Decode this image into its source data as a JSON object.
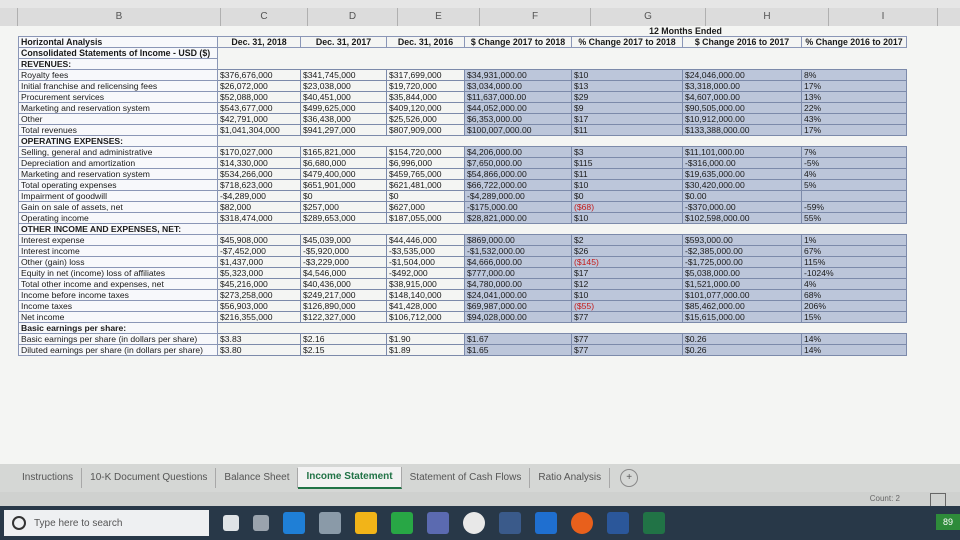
{
  "columns": [
    "B",
    "C",
    "D",
    "E",
    "F",
    "G",
    "H",
    "I"
  ],
  "header": {
    "group_title": "12 Months Ended",
    "title1": "Horizontal Analysis",
    "title2": "Consolidated Statements of Income - USD ($)",
    "cols": [
      "Dec. 31, 2018",
      "Dec. 31, 2017",
      "Dec. 31, 2016",
      "$ Change 2017 to 2018",
      "% Change 2017 to 2018",
      "$ Change 2016 to 2017",
      "% Change 2016 to 2017"
    ]
  },
  "sections": [
    {
      "title": "REVENUES:",
      "rows": [
        {
          "label": "Royalty fees",
          "v": [
            "$376,676,000",
            "$341,745,000",
            "$317,699,000",
            "$34,931,000.00",
            "$10",
            "$24,046,000.00",
            "8%"
          ]
        },
        {
          "label": "Initial franchise and relicensing fees",
          "v": [
            "$26,072,000",
            "$23,038,000",
            "$19,720,000",
            "$3,034,000.00",
            "$13",
            "$3,318,000.00",
            "17%"
          ]
        },
        {
          "label": "Procurement services",
          "v": [
            "$52,088,000",
            "$40,451,000",
            "$35,844,000",
            "$11,637,000.00",
            "$29",
            "$4,607,000.00",
            "13%"
          ]
        },
        {
          "label": "Marketing and reservation system",
          "v": [
            "$543,677,000",
            "$499,625,000",
            "$409,120,000",
            "$44,052,000.00",
            "$9",
            "$90,505,000.00",
            "22%"
          ]
        },
        {
          "label": "Other",
          "v": [
            "$42,791,000",
            "$36,438,000",
            "$25,526,000",
            "$6,353,000.00",
            "$17",
            "$10,912,000.00",
            "43%"
          ]
        },
        {
          "label": "Total revenues",
          "v": [
            "$1,041,304,000",
            "$941,297,000",
            "$807,909,000",
            "$100,007,000.00",
            "$11",
            "$133,388,000.00",
            "17%"
          ]
        }
      ]
    },
    {
      "title": "OPERATING EXPENSES:",
      "rows": [
        {
          "label": "Selling, general and administrative",
          "v": [
            "$170,027,000",
            "$165,821,000",
            "$154,720,000",
            "$4,206,000.00",
            "$3",
            "$11,101,000.00",
            "7%"
          ]
        },
        {
          "label": "Depreciation and amortization",
          "v": [
            "$14,330,000",
            "$6,680,000",
            "$6,996,000",
            "$7,650,000.00",
            "$115",
            "-$316,000.00",
            "-5%"
          ]
        },
        {
          "label": "Marketing and reservation system",
          "v": [
            "$534,266,000",
            "$479,400,000",
            "$459,765,000",
            "$54,866,000.00",
            "$11",
            "$19,635,000.00",
            "4%"
          ]
        },
        {
          "label": "Total operating expenses",
          "v": [
            "$718,623,000",
            "$651,901,000",
            "$621,481,000",
            "$66,722,000.00",
            "$10",
            "$30,420,000.00",
            "5%"
          ]
        },
        {
          "label": "Impairment of goodwill",
          "v": [
            "-$4,289,000",
            "$0",
            "$0",
            "-$4,289,000.00",
            "$0",
            "$0.00",
            ""
          ]
        },
        {
          "label": "Gain on sale of assets, net",
          "v": [
            "$82,000",
            "$257,000",
            "$627,000",
            "-$175,000.00",
            "($68)",
            "-$370,000.00",
            "-59%"
          ]
        },
        {
          "label": "Operating income",
          "v": [
            "$318,474,000",
            "$289,653,000",
            "$187,055,000",
            "$28,821,000.00",
            "$10",
            "$102,598,000.00",
            "55%"
          ]
        }
      ]
    },
    {
      "title": "OTHER INCOME AND EXPENSES, NET:",
      "rows": [
        {
          "label": "Interest expense",
          "v": [
            "$45,908,000",
            "$45,039,000",
            "$44,446,000",
            "$869,000.00",
            "$2",
            "$593,000.00",
            "1%"
          ]
        },
        {
          "label": "Interest income",
          "v": [
            "-$7,452,000",
            "-$5,920,000",
            "-$3,535,000",
            "-$1,532,000.00",
            "$26",
            "-$2,385,000.00",
            "67%"
          ]
        },
        {
          "label": "Other (gain) loss",
          "v": [
            "$1,437,000",
            "-$3,229,000",
            "-$1,504,000",
            "$4,666,000.00",
            "($145)",
            "-$1,725,000.00",
            "115%"
          ]
        },
        {
          "label": "Equity in net (income) loss of affiliates",
          "v": [
            "$5,323,000",
            "$4,546,000",
            "-$492,000",
            "$777,000.00",
            "$17",
            "$5,038,000.00",
            "-1024%"
          ]
        },
        {
          "label": "Total other income and expenses, net",
          "v": [
            "$45,216,000",
            "$40,436,000",
            "$38,915,000",
            "$4,780,000.00",
            "$12",
            "$1,521,000.00",
            "4%"
          ]
        },
        {
          "label": "Income before income taxes",
          "v": [
            "$273,258,000",
            "$249,217,000",
            "$148,140,000",
            "$24,041,000.00",
            "$10",
            "$101,077,000.00",
            "68%"
          ]
        },
        {
          "label": "Income taxes",
          "v": [
            "$56,903,000",
            "$126,890,000",
            "$41,428,000",
            "$69,987,000.00",
            "($55)",
            "$85,462,000.00",
            "206%"
          ]
        },
        {
          "label": "Net income",
          "v": [
            "$216,355,000",
            "$122,327,000",
            "$106,712,000",
            "$94,028,000.00",
            "$77",
            "$15,615,000.00",
            "15%"
          ]
        }
      ]
    },
    {
      "title": "Basic earnings per share:",
      "rows": [
        {
          "label": "Basic earnings per share (in dollars per share)",
          "v": [
            "$3.83",
            "$2.16",
            "$1.90",
            "$1.67",
            "$77",
            "$0.26",
            "14%"
          ]
        },
        {
          "label": "Diluted earnings per share (in dollars per share)",
          "v": [
            "$3.80",
            "$2.15",
            "$1.89",
            "$1.65",
            "$77",
            "$0.26",
            "14%"
          ]
        }
      ]
    }
  ],
  "tabs": [
    "Instructions",
    "10-K Document Questions",
    "Balance Sheet",
    "Income Statement",
    "Statement of Cash Flows",
    "Ratio Analysis"
  ],
  "active_tab": "Income Statement",
  "status": {
    "count": "Count: 2"
  },
  "taskbar": {
    "search_placeholder": "Type here to search",
    "battery": "89"
  },
  "colors": {
    "shade": "#bcc6da",
    "negative": "#c41a1a",
    "excel_green": "#217346"
  }
}
